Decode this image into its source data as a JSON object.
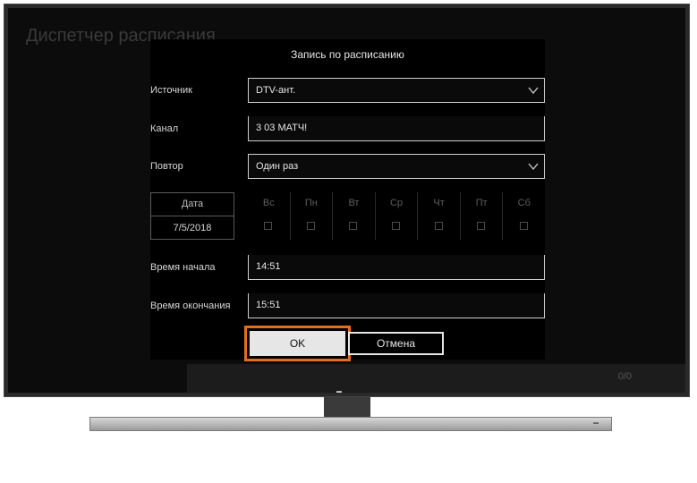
{
  "background": {
    "title": "Диспетчер расписания",
    "bottom_text": "0/0"
  },
  "dialog": {
    "title": "Запись по расписанию",
    "source": {
      "label": "Источник",
      "value": "DTV-ант."
    },
    "channel": {
      "label": "Канал",
      "value": "3 03 МАТЧ!"
    },
    "repeat": {
      "label": "Повтор",
      "value": "Один раз"
    },
    "date": {
      "label": "Дата",
      "value": "7/5/2018"
    },
    "days": [
      "Вс",
      "Пн",
      "Вт",
      "Ср",
      "Чт",
      "Пт",
      "Сб"
    ],
    "start_time": {
      "label": "Время начала",
      "value": "14:51"
    },
    "end_time": {
      "label": "Время окончания",
      "value": "15:51"
    },
    "ok_label": "OK",
    "cancel_label": "Отмена"
  },
  "colors": {
    "highlight": "#e0701f",
    "dialog_bg": "#000000",
    "ok_bg": "#e6e6e6"
  }
}
